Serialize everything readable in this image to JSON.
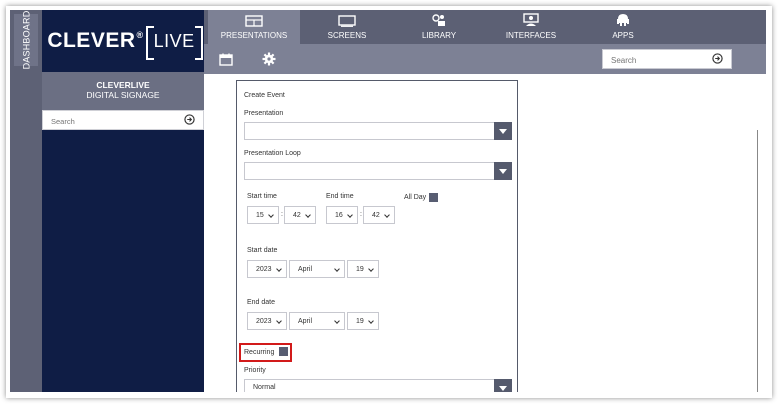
{
  "sidebar_strip": {
    "label": "DASHBOARD"
  },
  "brand": {
    "name": "CLEVER",
    "reg": "®",
    "live": "LIVE"
  },
  "sidebar": {
    "title_line1": "CLEVERLIVE",
    "title_line2": "DIGITAL SIGNAGE",
    "search_placeholder": "Search"
  },
  "nav": {
    "tabs": [
      {
        "label": "PRESENTATIONS",
        "icon": "presentations-icon",
        "active": true
      },
      {
        "label": "SCREENS",
        "icon": "screen-icon",
        "active": false
      },
      {
        "label": "LIBRARY",
        "icon": "library-icon",
        "active": false
      },
      {
        "label": "INTERFACES",
        "icon": "interfaces-icon",
        "active": false
      },
      {
        "label": "APPS",
        "icon": "apps-icon",
        "active": false
      }
    ]
  },
  "subbar": {
    "search_placeholder": "Search"
  },
  "form": {
    "title": "Create Event",
    "presentation_label": "Presentation",
    "presentation_value": "",
    "loop_label": "Presentation Loop",
    "loop_value": "",
    "start_time_label": "Start time",
    "start_hour": "15",
    "start_min": "42",
    "end_time_label": "End time",
    "end_hour": "16",
    "end_min": "42",
    "time_sep": ":",
    "all_day_label": "All Day",
    "start_date_label": "Start date",
    "start_year": "2023",
    "start_month": "April",
    "start_day": "19",
    "end_date_label": "End date",
    "end_year": "2023",
    "end_month": "April",
    "end_day": "19",
    "recurring_label": "Recurring",
    "priority_label": "Priority",
    "priority_value": "Normal"
  },
  "colors": {
    "navy": "#0f1d45",
    "nav_bg": "#5c6074",
    "nav_active": "#7d8195",
    "highlight": "#d21a1a"
  }
}
